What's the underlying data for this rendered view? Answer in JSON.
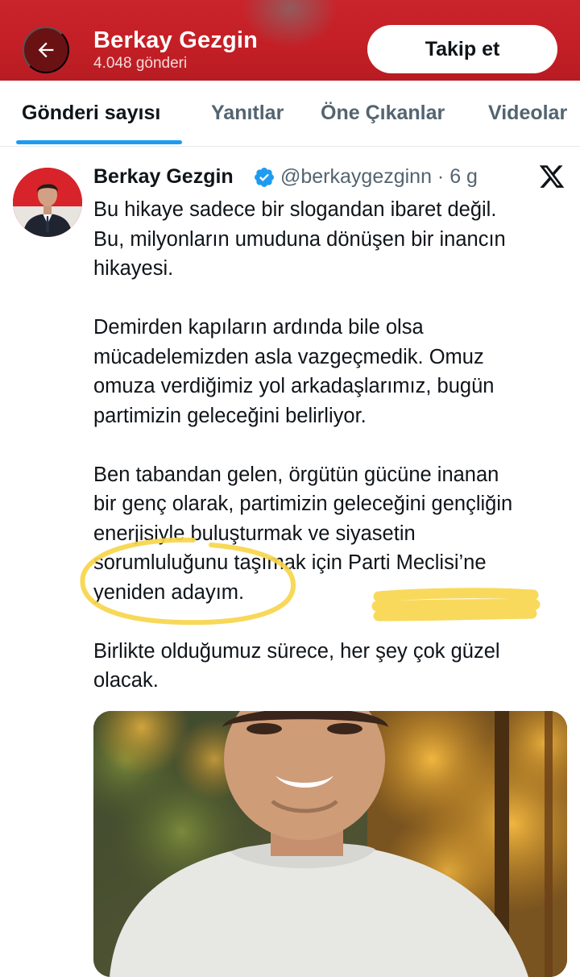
{
  "header": {
    "profile_name": "Berkay Gezgin",
    "post_count": "4.048 gönderi",
    "follow_label": "Takip et",
    "background_color": "#c41f26"
  },
  "tabs": [
    {
      "label": "Gönderi sayısı",
      "active": true
    },
    {
      "label": "Yanıtlar",
      "active": false
    },
    {
      "label": "Öne Çıkanlar",
      "active": false
    },
    {
      "label": "Videolar",
      "active": false
    }
  ],
  "post": {
    "author_name": "Berkay Gezgin",
    "handle_time": "@berkaygezginn · 6 g",
    "verified": true,
    "paragraphs": [
      "Bu hikaye sadece bir slogandan ibaret değil.\nBu, milyonların umuduna dönüşen bir inancın\nhikayesi.",
      "Demirden kapıların ardında bile olsa\nmücadelemizden asla vazgeçmedik. Omuz\nomuza verdiğimiz yol arkadaşlarımız, bugün\npartimizin geleceğini belirliyor.",
      "Ben tabandan gelen, örgütün gücüne inanan\nbir genç olarak, partimizin geleceğini gençliğin\nenerjisiyle buluşturmak ve siyasetin\nsorumluluğunu taşımak için Parti Meclisi’ne\nyeniden adayım.",
      "Birlikte olduğumuz sürece, her şey çok güzel\nolacak."
    ]
  },
  "colors": {
    "accent": "#1d9bf0",
    "text": "#0f1419",
    "muted": "#536471",
    "highlight": "#f7d54a"
  },
  "icons": {
    "back": "arrow-left-icon",
    "verified": "verified-badge-icon",
    "platform": "x-logo-icon"
  }
}
